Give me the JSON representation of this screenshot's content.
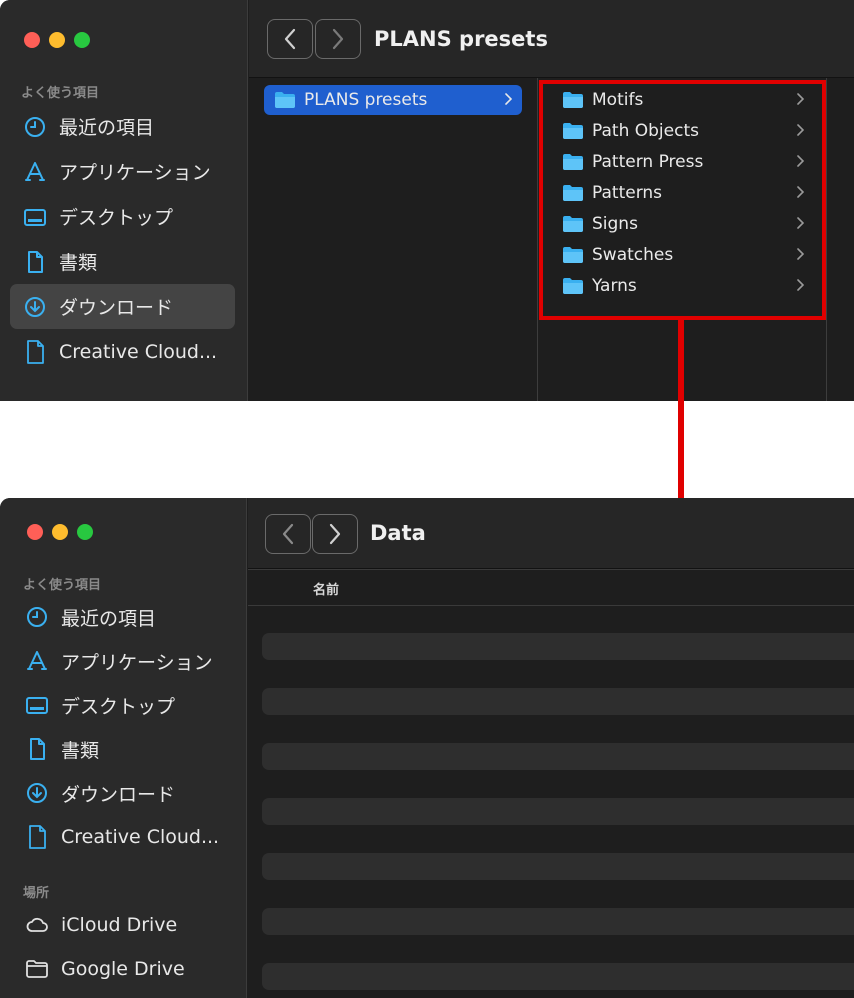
{
  "colors": {
    "accent": "#1f5fcf",
    "annotation": "#e00000",
    "folder": "#3ab0f0"
  },
  "top_window": {
    "title": "PLANS presets",
    "sidebar": {
      "favorites_header": "よく使う項目",
      "items": [
        {
          "label": "最近の項目",
          "icon": "clock-icon"
        },
        {
          "label": "アプリケーション",
          "icon": "applications-icon"
        },
        {
          "label": "デスクトップ",
          "icon": "desktop-icon"
        },
        {
          "label": "書類",
          "icon": "document-icon"
        },
        {
          "label": "ダウンロード",
          "icon": "download-icon",
          "selected": true
        },
        {
          "label": "Creative Cloud...",
          "icon": "file-icon"
        }
      ]
    },
    "column1": {
      "selected": "PLANS presets"
    },
    "column2": {
      "folders": [
        "Motifs",
        "Path Objects",
        "Pattern Press",
        "Patterns",
        "Signs",
        "Swatches",
        "Yarns"
      ]
    }
  },
  "bottom_window": {
    "title": "Data",
    "sidebar": {
      "favorites_header": "よく使う項目",
      "items": [
        {
          "label": "最近の項目",
          "icon": "clock-icon"
        },
        {
          "label": "アプリケーション",
          "icon": "applications-icon"
        },
        {
          "label": "デスクトップ",
          "icon": "desktop-icon"
        },
        {
          "label": "書類",
          "icon": "document-icon"
        },
        {
          "label": "ダウンロード",
          "icon": "download-icon"
        },
        {
          "label": "Creative Cloud...",
          "icon": "file-icon"
        }
      ],
      "locations_header": "場所",
      "locations": [
        {
          "label": "iCloud Drive",
          "icon": "cloud-icon"
        },
        {
          "label": "Google Drive",
          "icon": "folder-outline-icon"
        }
      ]
    },
    "list": {
      "name_header": "名前"
    }
  }
}
